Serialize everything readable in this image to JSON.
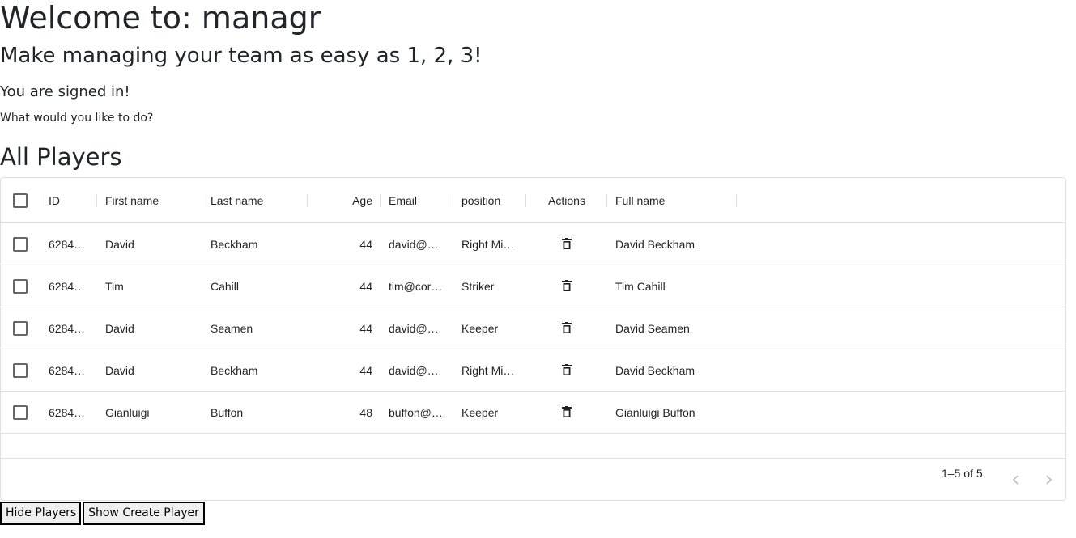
{
  "page": {
    "title": "Welcome to: managr",
    "subtitle": "Make managing your team as easy as 1, 2, 3!",
    "signed_in": "You are signed in!",
    "prompt": "What would you like to do?",
    "section_title": "All Players"
  },
  "table": {
    "columns": [
      "ID",
      "First name",
      "Last name",
      "Age",
      "Email",
      "position",
      "Actions",
      "Full name"
    ],
    "rows": [
      {
        "id": "6284…",
        "first": "David",
        "last": "Beckham",
        "age": "44",
        "email": "david@…",
        "position": "Right Mi…",
        "full": "David Beckham"
      },
      {
        "id": "6284…",
        "first": "Tim",
        "last": "Cahill",
        "age": "44",
        "email": "tim@cor…",
        "position": "Striker",
        "full": "Tim Cahill"
      },
      {
        "id": "6284…",
        "first": "David",
        "last": "Seamen",
        "age": "44",
        "email": "david@…",
        "position": "Keeper",
        "full": "David Seamen"
      },
      {
        "id": "6284…",
        "first": "David",
        "last": "Beckham",
        "age": "44",
        "email": "david@…",
        "position": "Right Mi…",
        "full": "David Beckham"
      },
      {
        "id": "6284…",
        "first": "Gianluigi",
        "last": "Buffon",
        "age": "48",
        "email": "buffon@…",
        "position": "Keeper",
        "full": "Gianluigi Buffon"
      }
    ],
    "pagination": "1–5 of 5",
    "icons": {
      "select": "checkbox-icon",
      "delete": "trash-icon",
      "prev": "chevron-left-icon",
      "next": "chevron-right-icon"
    }
  },
  "buttons": {
    "hide_players": "Hide Players",
    "show_create_player": "Show Create Player"
  }
}
